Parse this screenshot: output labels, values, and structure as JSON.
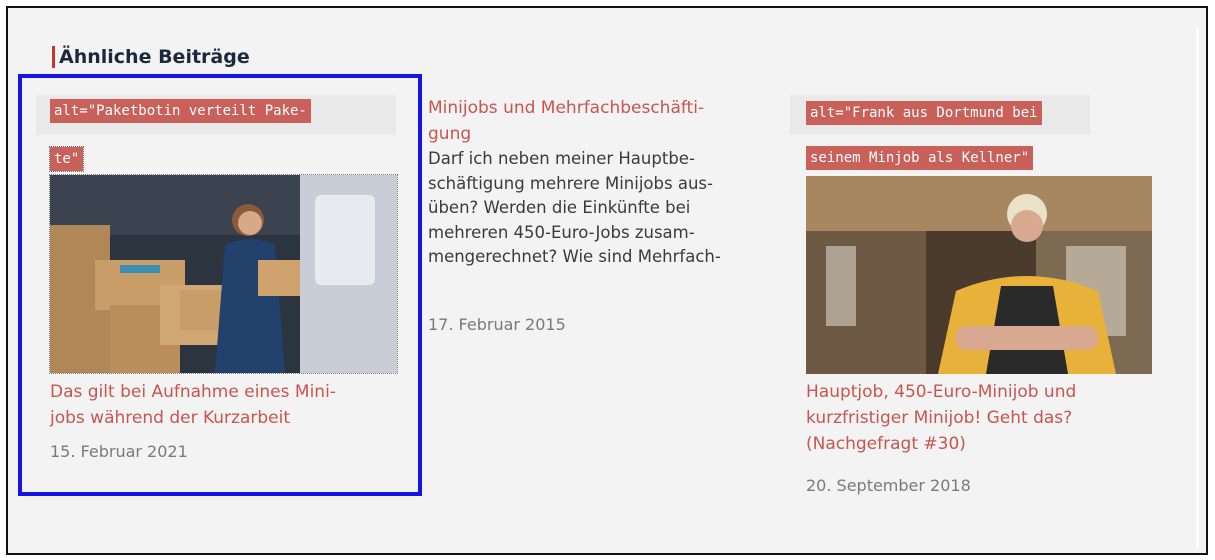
{
  "section": {
    "heading": "Ähnliche Beiträge"
  },
  "colors": {
    "accent_red": "#c9554f",
    "selection_blue": "#1414e6",
    "alt_bg": "#c9615a"
  },
  "cards": [
    {
      "alt_line1": "alt=\"Paketbotin verteilt Pake-",
      "alt_line2": "te\"",
      "image_icon": "delivery-photo",
      "title_line1": "Das gilt bei Aufnahme eines Mini-",
      "title_line2": "jobs während der Kurzarbeit",
      "date": "15. Februar 2021"
    },
    {
      "title_line1": "Minijobs und Mehrfachbeschäfti-",
      "title_line2": "gung",
      "teaser_lines": [
        "Darf ich neben meiner Hauptbe-",
        "schäftigung mehrere Minijobs aus-",
        "üben? Werden die Einkünfte bei",
        "mehreren 450-Euro-Jobs zusam-",
        "mengerechnet? Wie sind Mehrfach-"
      ],
      "date": "17. Februar 2015"
    },
    {
      "alt_line1": "alt=\"Frank aus Dortmund bei",
      "alt_line2": "seinem Minjob als Kellner\"",
      "image_icon": "waiter-photo",
      "title_line1": "Hauptjob, 450-Euro-Minijob und",
      "title_line2": "kurzfristiger Minijob! Geht das?",
      "title_line3": "(Nachgefragt #30)",
      "date": "20. September 2018"
    }
  ]
}
